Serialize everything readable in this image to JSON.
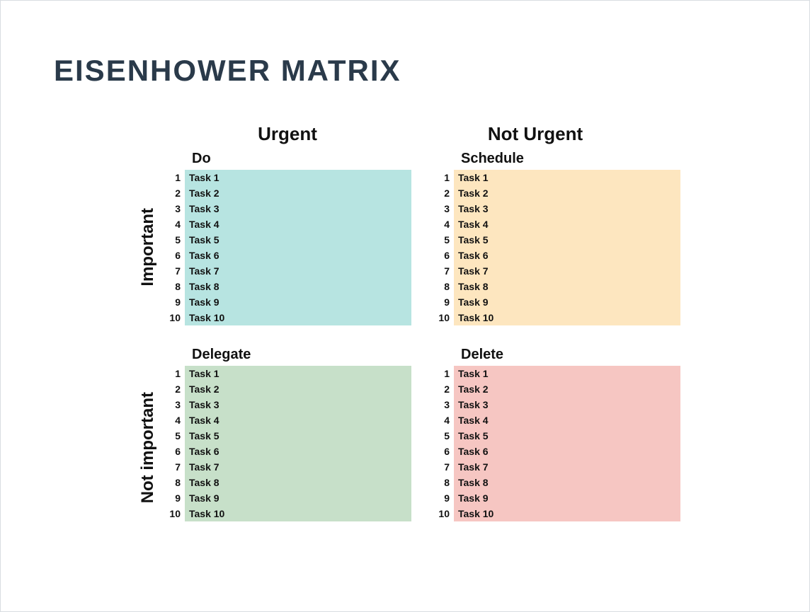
{
  "title": "EISENHOWER MATRIX",
  "columns": {
    "urgent": "Urgent",
    "not_urgent": "Not Urgent"
  },
  "rows": {
    "important": "Important",
    "not_important": "Not important"
  },
  "quadrants": {
    "do": {
      "title": "Do",
      "color": "#b7e4e1",
      "tasks": [
        "Task 1",
        "Task 2",
        "Task 3",
        "Task 4",
        "Task 5",
        "Task 6",
        "Task 7",
        "Task 8",
        "Task 9",
        "Task 10"
      ]
    },
    "schedule": {
      "title": "Schedule",
      "color": "#fde6bf",
      "tasks": [
        "Task 1",
        "Task 2",
        "Task 3",
        "Task 4",
        "Task 5",
        "Task 6",
        "Task 7",
        "Task 8",
        "Task 9",
        "Task 10"
      ]
    },
    "delegate": {
      "title": "Delegate",
      "color": "#c7e0c9",
      "tasks": [
        "Task 1",
        "Task 2",
        "Task 3",
        "Task 4",
        "Task 5",
        "Task 6",
        "Task 7",
        "Task 8",
        "Task 9",
        "Task 10"
      ]
    },
    "delete": {
      "title": "Delete",
      "color": "#f6c6c2",
      "tasks": [
        "Task 1",
        "Task 2",
        "Task 3",
        "Task 4",
        "Task 5",
        "Task 6",
        "Task 7",
        "Task 8",
        "Task 9",
        "Task 10"
      ]
    }
  }
}
